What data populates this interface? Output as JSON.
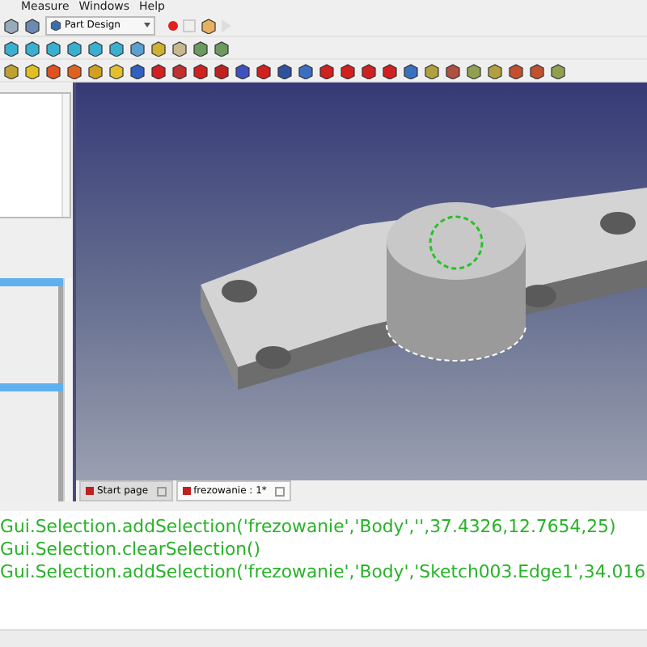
{
  "menu": [
    "Measure",
    "Windows",
    "Help"
  ],
  "workbench": {
    "value": "Part Design"
  },
  "tabs": [
    {
      "label": "Start page",
      "selected": false
    },
    {
      "label": "frezowanie : 1*",
      "selected": true
    }
  ],
  "console": [
    "Gui.Selection.addSelection('frezowanie','Body','',37.4326,12.7654,25)",
    "Gui.Selection.clearSelection()",
    "Gui.Selection.addSelection('frezowanie','Body','Sketch003.Edge1',34.016"
  ]
}
